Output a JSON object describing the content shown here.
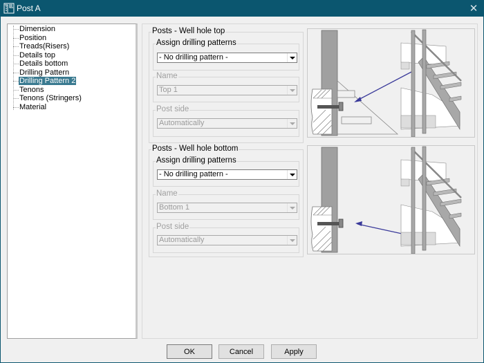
{
  "window": {
    "title": "Post A",
    "close_glyph": "✕"
  },
  "tree": {
    "items": [
      {
        "label": "Dimension",
        "selected": false
      },
      {
        "label": "Position",
        "selected": false
      },
      {
        "label": "Treads(Risers)",
        "selected": false
      },
      {
        "label": "Details top",
        "selected": false
      },
      {
        "label": "Details bottom",
        "selected": false
      },
      {
        "label": "Drilling Pattern",
        "selected": false
      },
      {
        "label": "Drilling Pattern 2",
        "selected": true
      },
      {
        "label": "Tenons",
        "selected": false
      },
      {
        "label": "Tenons (Stringers)",
        "selected": false
      },
      {
        "label": "Material",
        "selected": false
      }
    ]
  },
  "top_section": {
    "title": "Posts - Well hole top",
    "assign": {
      "label": "Assign drilling patterns",
      "value": "- No drilling pattern -"
    },
    "name": {
      "label": "Name",
      "value": "Top 1"
    },
    "post_side": {
      "label": "Post side",
      "value": "Automatically"
    }
  },
  "bottom_section": {
    "title": "Posts - Well hole bottom",
    "assign": {
      "label": "Assign drilling patterns",
      "value": "- No drilling pattern -"
    },
    "name": {
      "label": "Name",
      "value": "Bottom 1"
    },
    "post_side": {
      "label": "Post side",
      "value": "Automatically"
    }
  },
  "colors": {
    "titlebar": "#0b566f",
    "selection": "#3a7a90",
    "arrow": "#3a3a9a"
  },
  "buttons": {
    "ok": "OK",
    "cancel": "Cancel",
    "apply": "Apply"
  }
}
